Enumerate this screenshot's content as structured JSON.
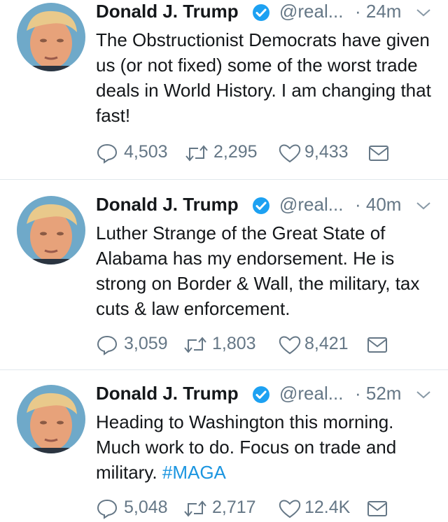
{
  "colors": {
    "verified": "#1da1f2",
    "hashtag": "#1b95e0",
    "muted": "#657786"
  },
  "tweets": [
    {
      "name": "Donald J. Trump",
      "handle": "@real...",
      "time": "· 24m",
      "text": "The Obstructionist Democrats have given us (or not fixed) some of the worst trade deals in World History. I am changing that fast!",
      "hashtag": "",
      "replies": "4,503",
      "retweets": "2,295",
      "likes": "9,433"
    },
    {
      "name": "Donald J. Trump",
      "handle": "@real...",
      "time": "· 40m",
      "text": "Luther Strange of the Great State of Alabama has my endorsement. He is strong on Border & Wall, the military, tax cuts & law enforcement.",
      "hashtag": "",
      "replies": "3,059",
      "retweets": "1,803",
      "likes": "8,421"
    },
    {
      "name": "Donald J. Trump",
      "handle": "@real...",
      "time": "· 52m",
      "text": "Heading to Washington this morning. Much work to do. Focus on trade and military. ",
      "hashtag": "#MAGA",
      "replies": "5,048",
      "retweets": "2,717",
      "likes": "12.4K"
    }
  ]
}
